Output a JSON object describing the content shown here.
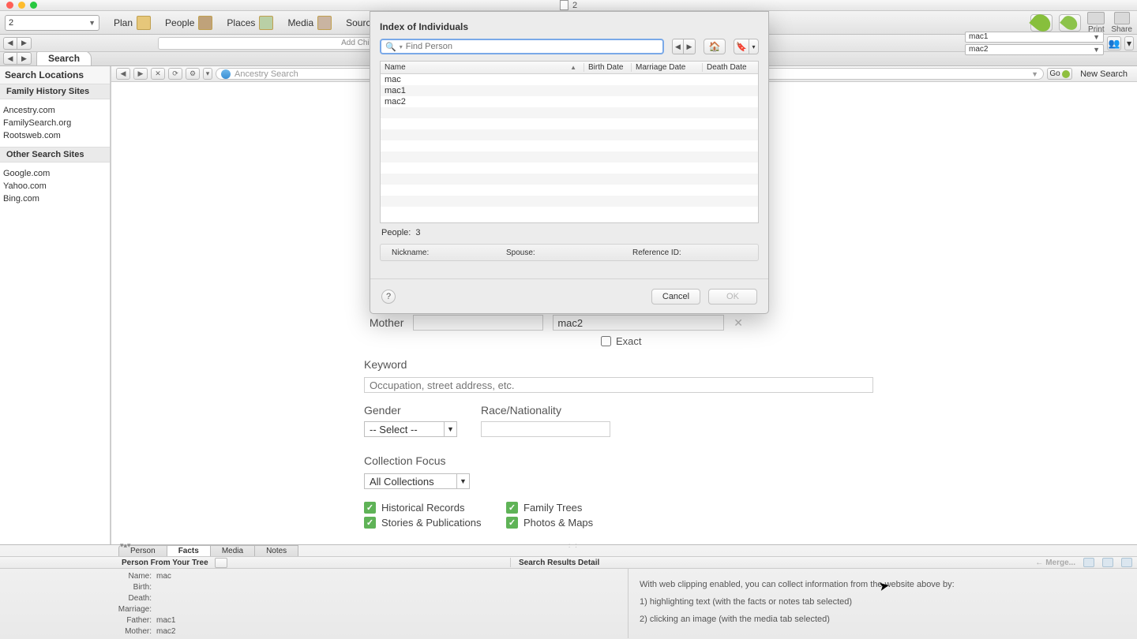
{
  "window_title": "2",
  "toolbar": {
    "plan_combo": "2",
    "plan": "Plan",
    "people": "People",
    "places": "Places",
    "media": "Media",
    "sources": "Source",
    "print": "Print",
    "share": "Share"
  },
  "secondary": {
    "add_child": "Add Child...",
    "combo1": "mac1",
    "combo2": "mac2"
  },
  "tabs": {
    "search": "Search"
  },
  "sidebar": {
    "title": "Search Locations",
    "group1_title": "Family History Sites",
    "group1": [
      "Ancestry.com",
      "FamilySearch.org",
      "Rootsweb.com"
    ],
    "group2_title": "Other Search Sites",
    "group2": [
      "Google.com",
      "Yahoo.com",
      "Bing.com"
    ]
  },
  "urlbar": {
    "placeholder": "Ancestry Search",
    "go": "Go",
    "new_search": "New Search"
  },
  "form": {
    "exact": "Exact",
    "mother_label": "Mother",
    "mother_last": "mac2",
    "keyword_label": "Keyword",
    "keyword_placeholder": "Occupation, street address, etc.",
    "gender_label": "Gender",
    "gender_value": "-- Select --",
    "race_label": "Race/Nationality",
    "coll_focus_label": "Collection Focus",
    "coll_focus_value": "All Collections",
    "chk_hist": "Historical Records",
    "chk_trees": "Family Trees",
    "chk_stories": "Stories & Publications",
    "chk_photos": "Photos & Maps"
  },
  "bottom": {
    "tabs": {
      "person": "Person",
      "facts": "Facts",
      "media": "Media",
      "notes": "Notes"
    },
    "left_title": "Person From Your Tree",
    "right_title": "Search Results Detail",
    "merge": "Merge...",
    "facts": {
      "name_lbl": "Name:",
      "name_val": "mac",
      "birth_lbl": "Birth:",
      "birth_val": "",
      "death_lbl": "Death:",
      "death_val": "",
      "marriage_lbl": "Marriage:",
      "marriage_val": "",
      "father_lbl": "Father:",
      "father_val": "mac1",
      "mother_lbl": "Mother:",
      "mother_val": "mac2"
    },
    "tips": {
      "intro": "With web clipping enabled, you can collect information from the website above by:",
      "t1": "1) highlighting text (with the facts or notes tab selected)",
      "t2": "2) clicking an image (with the media tab selected)"
    }
  },
  "modal": {
    "title": "Index of Individuals",
    "search_placeholder": "Find Person",
    "cols": {
      "name": "Name",
      "birth": "Birth Date",
      "marriage": "Marriage Date",
      "death": "Death Date"
    },
    "rows": [
      "mac",
      "mac1",
      "mac2"
    ],
    "people_label": "People:",
    "people_count": "3",
    "nickname": "Nickname:",
    "spouse": "Spouse:",
    "refid": "Reference ID:",
    "cancel": "Cancel",
    "ok": "OK"
  }
}
